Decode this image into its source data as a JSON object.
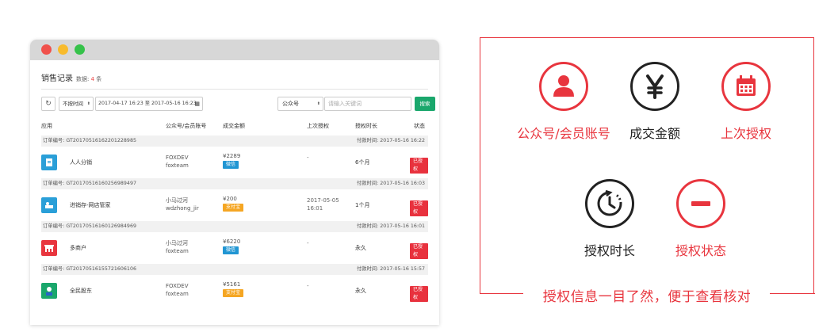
{
  "header": {
    "title": "销售记录",
    "count_prefix": "数据: ",
    "count_value": "4",
    "count_suffix": " 条"
  },
  "filters": {
    "refresh_icon": "refresh-icon",
    "time_select": "不按时间",
    "date_range": "2017-04-17 16:23 至 2017-05-16 16:23",
    "account_select": "公众号",
    "search_placeholder": "请输入关键词",
    "search_button": "搜索"
  },
  "table": {
    "columns": [
      "应用",
      "公众号/会员账号",
      "成交金额",
      "上次授权",
      "授权时长",
      "状态"
    ],
    "order_label": "订单编号:",
    "paytime_label": "付款时间:",
    "orders": [
      {
        "order_no": "GT20170516162201228985",
        "pay_time": "2017-05-16 16:22",
        "app": "人人分销",
        "icon": "distribution-app-icon",
        "icon_color": "#2a9fd8",
        "account": "FOXDEV",
        "account_sub": "foxteam",
        "amount": "¥2289",
        "pay_method": "微信",
        "pay_color": "#2196d3",
        "last_auth": "-",
        "last_auth_sub": "",
        "duration": "6个月",
        "status": "已授权"
      },
      {
        "order_no": "GT20170516160256989497",
        "pay_time": "2017-05-16 16:03",
        "app": "进销存-网店管家",
        "icon": "inventory-app-icon",
        "icon_color": "#2a9fd8",
        "account": "小马过河",
        "account_sub": "wdzhong_jir",
        "amount": "¥200",
        "pay_method": "支付宝",
        "pay_color": "#f5a623",
        "last_auth": "2017-05-05",
        "last_auth_sub": "16:01",
        "duration": "1个月",
        "status": "已授权"
      },
      {
        "order_no": "GT20170516160126984969",
        "pay_time": "2017-05-16 16:01",
        "app": "多商户",
        "icon": "multi-merchant-app-icon",
        "icon_color": "#e8353e",
        "account": "小马过河",
        "account_sub": "foxteam",
        "amount": "¥6220",
        "pay_method": "微信",
        "pay_color": "#2196d3",
        "last_auth": "-",
        "last_auth_sub": "",
        "duration": "永久",
        "status": "已授权"
      },
      {
        "order_no": "GT20170516155721606106",
        "pay_time": "2017-05-16 15:57",
        "app": "全民股东",
        "icon": "shareholder-app-icon",
        "icon_color": "#1aa76c",
        "account": "FOXDEV",
        "account_sub": "foxteam",
        "amount": "¥5161",
        "pay_method": "支付宝",
        "pay_color": "#f5a623",
        "last_auth": "-",
        "last_auth_sub": "",
        "duration": "永久",
        "status": "已授权"
      }
    ]
  },
  "panel": {
    "caption": "授权信息一目了然，便于查看核对",
    "features": [
      {
        "label": "公众号/会员账号",
        "icon": "user-icon",
        "style": "red"
      },
      {
        "label": "成交金额",
        "icon": "yen-icon",
        "style": "dark"
      },
      {
        "label": "上次授权",
        "icon": "calendar-icon",
        "style": "red"
      },
      {
        "label": "授权时长",
        "icon": "clock-icon",
        "style": "dark"
      },
      {
        "label": "授权状态",
        "icon": "minus-icon",
        "style": "red"
      }
    ],
    "accent_color": "#e8353e"
  }
}
